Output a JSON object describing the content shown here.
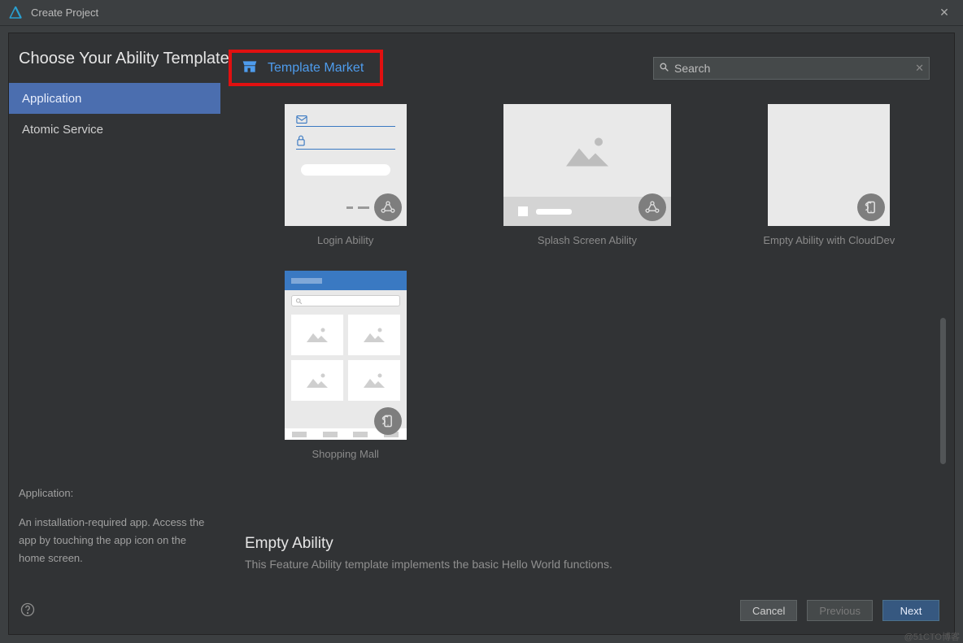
{
  "window": {
    "title": "Create Project"
  },
  "heading": "Choose Your Ability Template",
  "sidebar": {
    "items": [
      {
        "label": "Application",
        "selected": true
      },
      {
        "label": "Atomic Service",
        "selected": false
      }
    ],
    "description": {
      "label": "Application:",
      "body": "An installation-required app. Access the app by touching the app icon on the home screen."
    }
  },
  "main": {
    "market_label": "Template Market",
    "search": {
      "placeholder": "Search"
    },
    "templates": [
      {
        "label": "Login Ability",
        "kind": "login",
        "wide": false,
        "badge": "share"
      },
      {
        "label": "Splash Screen Ability",
        "kind": "splash",
        "wide": true,
        "badge": "share"
      },
      {
        "label": "Empty Ability with CloudDev",
        "kind": "empty",
        "wide": false,
        "badge": "cloud"
      },
      {
        "label": "Shopping Mall",
        "kind": "shop",
        "wide": false,
        "badge": "cloud"
      }
    ],
    "selected": {
      "title": "Empty Ability",
      "description": "This Feature Ability template implements the basic Hello World functions."
    }
  },
  "footer": {
    "cancel": "Cancel",
    "previous": "Previous",
    "next": "Next"
  },
  "watermark": "@51CTO博客"
}
